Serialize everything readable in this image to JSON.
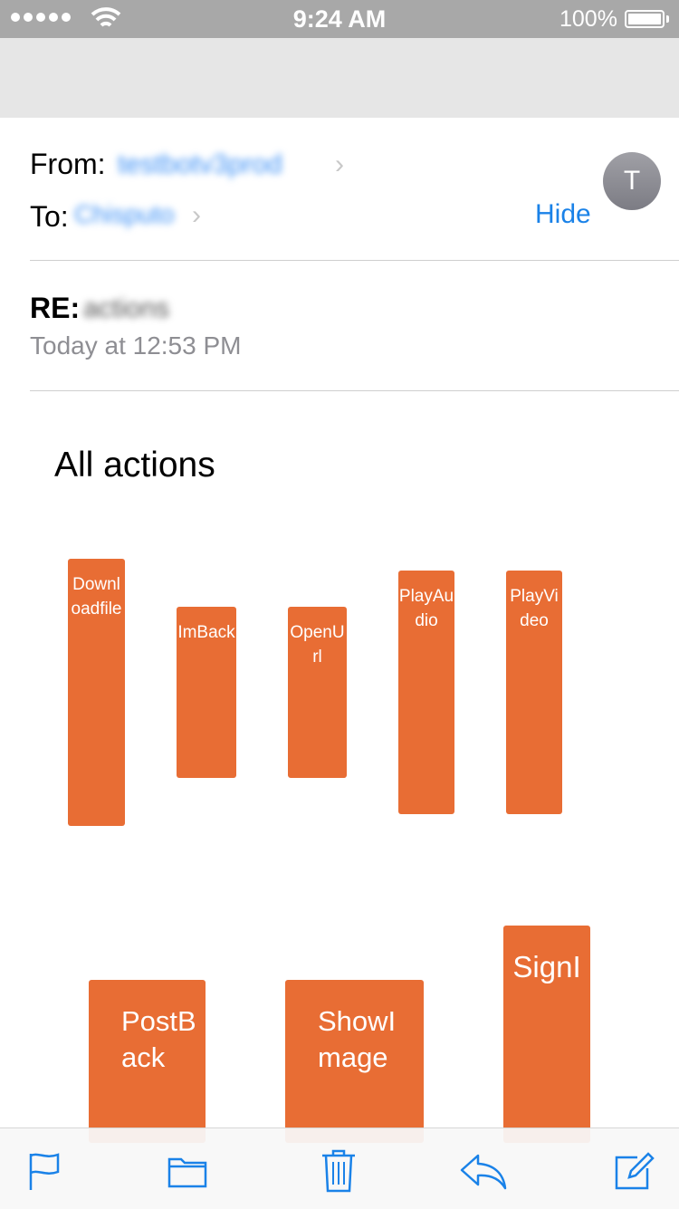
{
  "status_bar": {
    "time": "9:24 AM",
    "battery_percent": "100%",
    "signal_icon": "signal-dots-icon",
    "wifi_icon": "wifi-icon",
    "battery_icon": "battery-icon"
  },
  "header": {
    "from_label": "From:",
    "from_value": "testbotv3prod",
    "to_label": "To:",
    "to_value": "Chisputo",
    "hide_label": "Hide",
    "avatar_initial": "T"
  },
  "message": {
    "subject_prefix": "RE:",
    "subject_text": "actions",
    "date": "Today at 12:53 PM"
  },
  "content": {
    "title": "All actions",
    "actions_row1": [
      "Downloadfile",
      "ImBack",
      "OpenUrl",
      "PlayAudio",
      "PlayVideo"
    ],
    "actions_row2": [
      "PostBack",
      "ShowImage",
      "SignI"
    ]
  },
  "colors": {
    "accent": "#e86d34",
    "link": "#1a82e8",
    "status_bar": "#a8a8a8"
  },
  "toolbar": {
    "flag_icon": "flag-icon",
    "folder_icon": "folder-icon",
    "trash_icon": "trash-icon",
    "reply_icon": "reply-icon",
    "compose_icon": "compose-icon"
  }
}
